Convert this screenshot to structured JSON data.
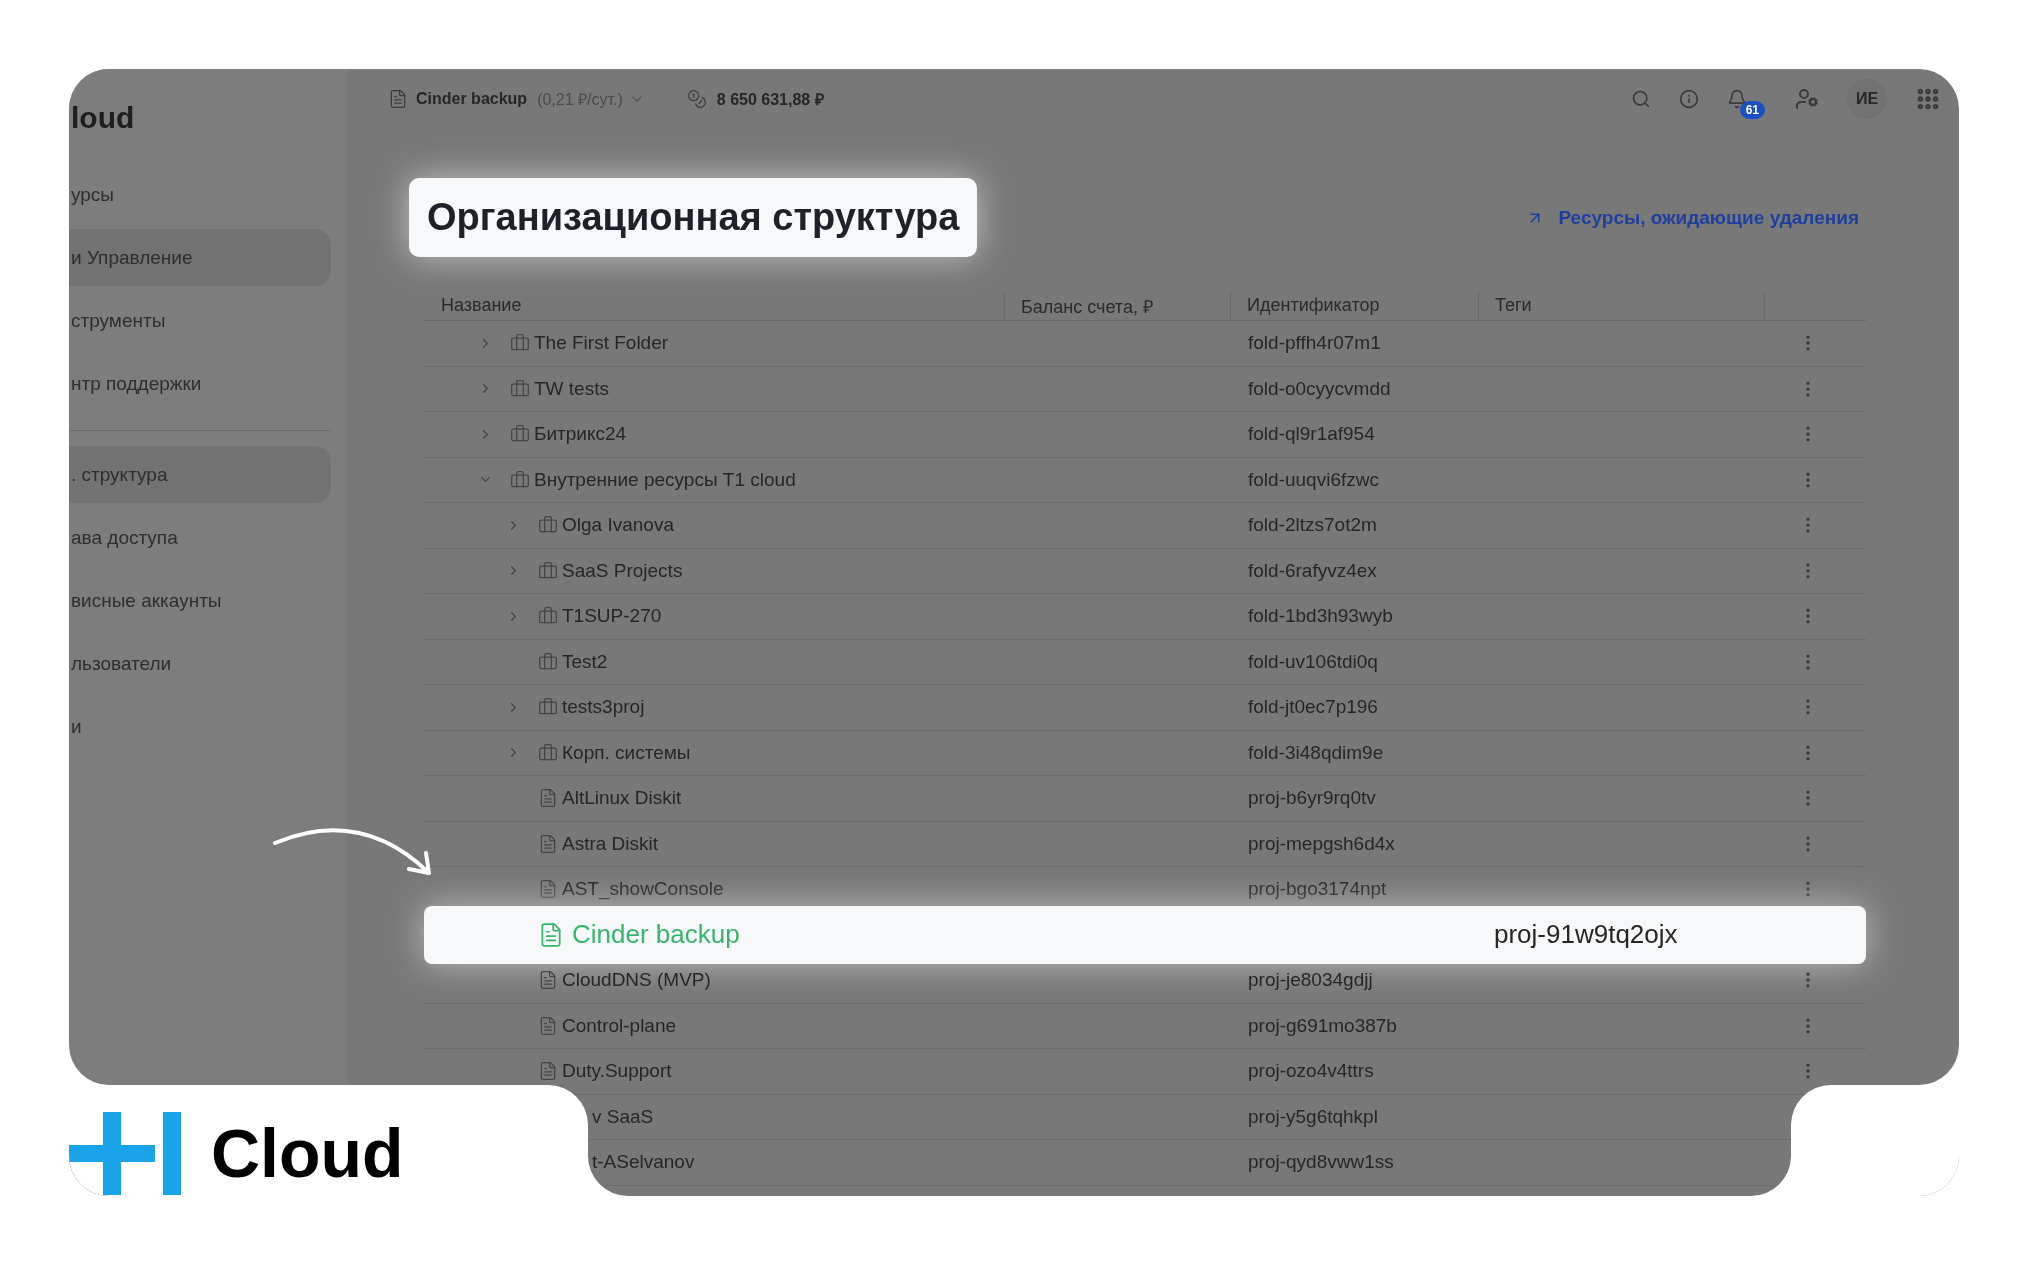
{
  "sidebar": {
    "brand": "loud",
    "groups": [
      {
        "items": [
          {
            "label": "урсы",
            "selected": false
          },
          {
            "label": "и Управление",
            "selected": true
          },
          {
            "label": "струменты",
            "selected": false
          },
          {
            "label": "нтр поддержки",
            "selected": false
          }
        ]
      },
      {
        "items": [
          {
            "label": ". структура",
            "selected": true
          },
          {
            "label": "ава доступа",
            "selected": false
          },
          {
            "label": "висные аккаунты",
            "selected": false
          },
          {
            "label": "льзователи",
            "selected": false
          },
          {
            "label": "и",
            "selected": false
          }
        ]
      }
    ]
  },
  "topbar": {
    "project": "Cinder backup",
    "rate": "(0,21 ₽/сут.)",
    "balance": "8 650 631,88 ₽",
    "notifications": "61",
    "avatar": "ИЕ"
  },
  "title": "Организационная структура",
  "link": "Ресурсы, ожидающие удаления",
  "table": {
    "columns": [
      "Название",
      "Баланс счета, ₽",
      "Идентификатор",
      "Теги"
    ],
    "rows": [
      {
        "name": "The First Folder",
        "kind": "folder",
        "expanded": false,
        "id": "fold-pffh4r07m1",
        "selected": false
      },
      {
        "name": "TW tests",
        "kind": "folder",
        "expanded": false,
        "id": "fold-o0cyycvmdd",
        "selected": false
      },
      {
        "name": "Битрикс24",
        "kind": "folder",
        "expanded": false,
        "id": "fold-ql9r1af954",
        "selected": false
      },
      {
        "name": "Внутренние ресурсы T1 cloud",
        "kind": "folder",
        "expanded": true,
        "id": "fold-uuqvi6fzwc",
        "selected": false,
        "children": [
          {
            "name": "Olga Ivanova",
            "kind": "folder",
            "expanded": false,
            "id": "fold-2ltzs7ot2m",
            "selected": false
          },
          {
            "name": "SaaS Projects",
            "kind": "folder",
            "expanded": false,
            "id": "fold-6rafyvz4ex",
            "selected": false
          },
          {
            "name": "T1SUP-270",
            "kind": "folder",
            "expanded": false,
            "id": "fold-1bd3h93wyb",
            "selected": false
          },
          {
            "name": "Test2",
            "kind": "folder",
            "id": "fold-uv106tdi0q",
            "selected": false
          },
          {
            "name": "tests3proj",
            "kind": "folder",
            "expanded": false,
            "id": "fold-jt0ec7p196",
            "selected": false
          },
          {
            "name": "Корп. системы",
            "kind": "folder",
            "expanded": false,
            "id": "fold-3i48qdim9e",
            "selected": false
          },
          {
            "name": "AltLinux Diskit",
            "kind": "project",
            "id": "proj-b6yr9rq0tv",
            "selected": false
          },
          {
            "name": "Astra Diskit",
            "kind": "project",
            "id": "proj-mepgsh6d4x",
            "selected": false
          },
          {
            "name": "AST_showConsole",
            "kind": "project",
            "id": "proj-bgo3174npt",
            "selected": false
          },
          {
            "name": "Cinder backup",
            "kind": "project",
            "id": "proj-91w9tq2ojx",
            "selected": true
          },
          {
            "name": "CloudDNS (MVP)",
            "kind": "project",
            "id": "proj-je8034gdjj",
            "selected": false
          },
          {
            "name": "Control-plane",
            "kind": "project",
            "id": "proj-g691mo387b",
            "selected": false
          },
          {
            "name": "Duty.Support",
            "kind": "project",
            "id": "proj-ozo4v4ttrs",
            "selected": false
          },
          {
            "name": "v SaaS",
            "kind": "project",
            "id": "proj-y5g6tqhkpl",
            "selected": false,
            "cut": true
          },
          {
            "name": "t-ASelvanov",
            "kind": "project",
            "id": "proj-qyd8vww1ss",
            "selected": false,
            "cut": true
          }
        ]
      }
    ]
  },
  "logo": {
    "text": "Cloud"
  }
}
